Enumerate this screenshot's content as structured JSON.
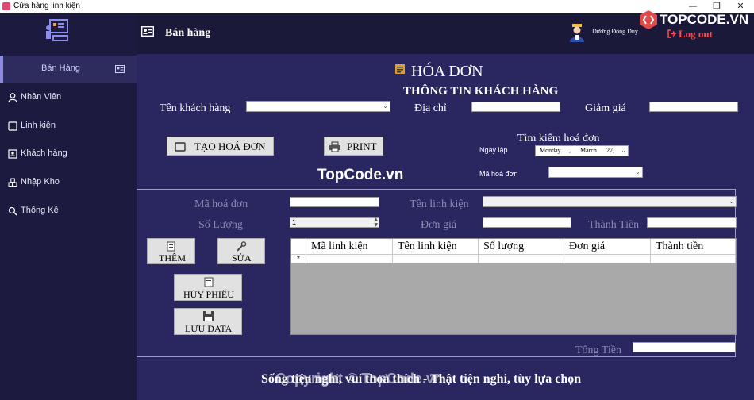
{
  "window": {
    "title": "Cửa hàng linh kiện",
    "min": "—",
    "max": "❐",
    "close": "✕"
  },
  "sidebar": {
    "items": [
      {
        "label": "Bán Hàng"
      },
      {
        "label": "Nhân Viên"
      },
      {
        "label": "Linh kiện"
      },
      {
        "label": "Khách hàng"
      },
      {
        "label": "Nhập Kho"
      },
      {
        "label": "Thống Kê"
      }
    ]
  },
  "header": {
    "title": "Bán hàng",
    "user": "Dương Đông Duy",
    "logout": "Log out"
  },
  "invoice": {
    "title": "HÓA ĐƠN",
    "customer_section": "THÔNG TIN KHÁCH HÀNG",
    "customer_name_label": "Tên khách hàng",
    "address_label": "Địa chỉ",
    "discount_label": "Giảm giá",
    "create_button": "TẠO HOÁ ĐƠN",
    "print_button": "PRINT",
    "search_title": "Tìm kiếm hoá đơn",
    "date_label": "Ngày lập",
    "date_value": {
      "weekday": "Monday",
      "sep": ",",
      "month": "March",
      "day": "27,"
    },
    "invoice_id_label": "Mã hoá đơn"
  },
  "detail": {
    "invoice_id_label": "Mã hoá đơn",
    "component_name_label": "Tên linh kiện",
    "quantity_label": "Số Lượng",
    "quantity_value": "1",
    "unit_price_label": "Đơn giá",
    "total_label": "Thành Tiền",
    "add_button": "THÊM",
    "edit_button": "SỬA",
    "cancel_button": "HỦY PHIẾU",
    "save_button": "LƯU DATA",
    "grand_total_label": "Tổng Tiền"
  },
  "grid": {
    "columns": [
      "Mã linh kiện",
      "Tên linh kiện",
      "Số lượng",
      "Đơn giá",
      "Thành tiền"
    ],
    "new_row_marker": "*"
  },
  "watermarks": {
    "logo": "TOPCODE.VN",
    "center": "TopCode.vn",
    "footer_slogan": "Sống tiện nghi, vui thoả thích - Thật tiện nghi, tùy lựa chọn",
    "footer_copyright": "Copyright © TopCode.vn"
  }
}
